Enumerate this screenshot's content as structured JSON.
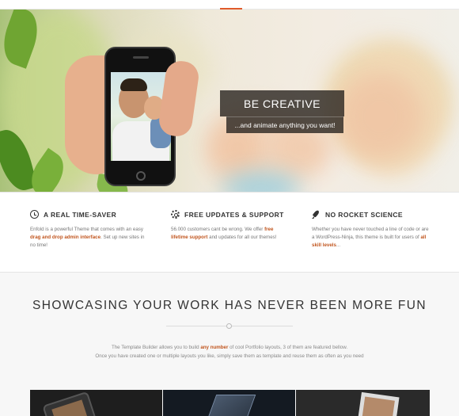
{
  "hero": {
    "caption_title": "BE CREATIVE",
    "caption_subtitle": "...and animate anything you want!"
  },
  "features": [
    {
      "icon": "clock-icon",
      "title": "A REAL TIME-SAVER",
      "text_1": "Enfold is a powerful Theme that comes with an easy ",
      "link": "drag and drop admin interface",
      "text_2": ". Set up new sites in no time!"
    },
    {
      "icon": "gear-icon",
      "title": "FREE UPDATES & SUPPORT",
      "text_1": "56.000 customers cant be wrong. We offer ",
      "link": "free lifetime support",
      "text_2": " and updates for all our themes!"
    },
    {
      "icon": "rocket-icon",
      "title": "NO ROCKET SCIENCE",
      "text_1": "Whether you have never touched a line of code or are a WordPress-Ninja, this theme is built for users of ",
      "link": "all skill levels",
      "text_2": "..."
    }
  ],
  "showcase": {
    "heading": "SHOWCASING YOUR WORK HAS NEVER BEEN MORE FUN",
    "desc_part1": "The Template Builder allows you to build ",
    "desc_link": "any number",
    "desc_part2": " of cool Portfolio layouts, 3 of them are featured bellow.",
    "desc_line2": "Once you have created one or multiple layouts you like, simply save them as template and reuse them as often as you need"
  },
  "colors": {
    "accent": "#c1561f",
    "caption_bg": "#2d2823"
  }
}
